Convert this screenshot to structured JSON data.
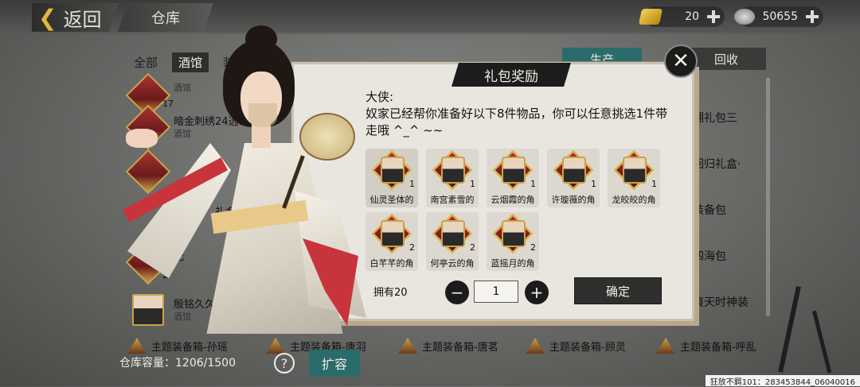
{
  "header": {
    "back_label": "返回",
    "title": "仓库",
    "gold_amount": "20",
    "silver_amount": "50655"
  },
  "filters": [
    {
      "label": "全部"
    },
    {
      "label": "酒馆"
    },
    {
      "label": "装备"
    }
  ],
  "right_tabs": {
    "produce": "生产",
    "recycle": "回收"
  },
  "left_list": [
    {
      "name": "",
      "category": "酒馆",
      "count": "17"
    },
    {
      "name": "暗金刺绣24选1",
      "category": "酒馆",
      "count": ""
    },
    {
      "name": "",
      "category": "",
      "count": ""
    },
    {
      "name": "礼盒",
      "category": "",
      "count": ""
    },
    {
      "name": "无",
      "category": "",
      "count": "2"
    },
    {
      "name": "殷铭久久心",
      "category": "酒馆",
      "count": ""
    }
  ],
  "right_list": [
    "翻礼包三",
    "回归礼盒·",
    "装备包",
    "四海包",
    "痕天时神装"
  ],
  "bottom_list": [
    "主题装备箱-孙瑶",
    "主题装备箱-唐羽",
    "主题装备箱-唐茗",
    "主题装备箱-顾灵",
    "主题装备箱-呼乱"
  ],
  "footer": {
    "capacity_label": "仓库容量：1206/1500",
    "help_icon": "?",
    "expand_label": "扩容",
    "id_text": "狂放不羁101：283453844_06040016"
  },
  "dialog": {
    "title": "礼包奖励",
    "close_icon": "✕",
    "greeting": "大侠:",
    "message": "奴家已经帮你准备好以下8件物品，你可以任意挑选1件带走哦 ^_^ ~~",
    "rewards": [
      {
        "name": "仙灵圣体的",
        "qty": "1",
        "selected": true
      },
      {
        "name": "南宫素雪的",
        "qty": "1",
        "selected": false
      },
      {
        "name": "云烟霞的角",
        "qty": "1",
        "selected": false
      },
      {
        "name": "许璇薇的角",
        "qty": "1",
        "selected": false
      },
      {
        "name": "龙皎皎的角",
        "qty": "1",
        "selected": false
      },
      {
        "name": "白芊芊的角",
        "qty": "2",
        "selected": false
      },
      {
        "name": "何亭云的角",
        "qty": "2",
        "selected": false
      },
      {
        "name": "蓝摇月的角",
        "qty": "2",
        "selected": false
      }
    ],
    "owned_label": "拥有20",
    "quantity_value": "1",
    "minus_icon": "−",
    "plus_icon": "+",
    "confirm_label": "确定"
  }
}
